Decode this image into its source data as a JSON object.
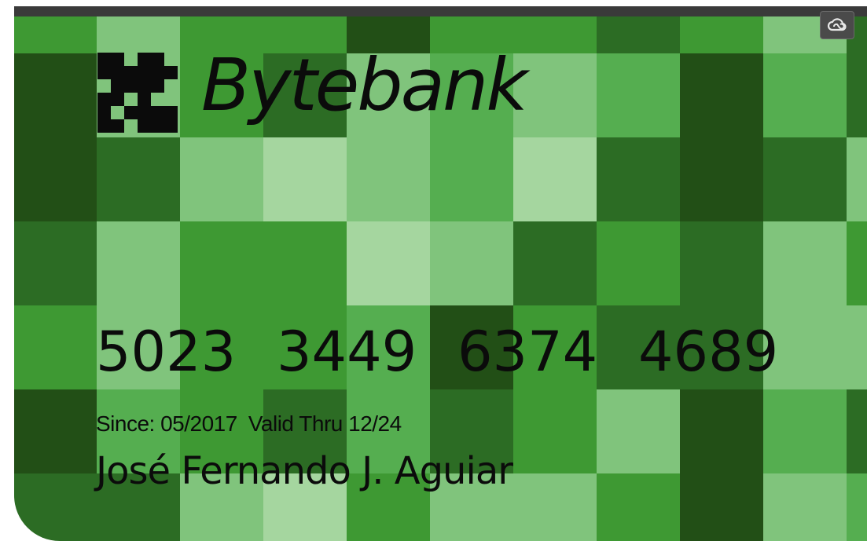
{
  "card": {
    "brand": "Bytebank",
    "logo_icon": "bytebank-pixel-logo-icon",
    "number_groups": [
      "5023",
      "3449",
      "6374",
      "4689"
    ],
    "since_label": "Since: 05/2017",
    "valid_label": "Valid Thru 12/24",
    "holder_name": "José Fernando J. Aguiar"
  },
  "toolbar": {
    "cloud_icon": "creative-cloud-icon"
  },
  "colors": {
    "top_bar": "#3a3a3a",
    "text": "#0b0b0b",
    "palette": {
      "D": "#224f16",
      "d": "#2c6c24",
      "M": "#3e9933",
      "m": "#55ae50",
      "l": "#80c47c",
      "L": "#a5d69f"
    },
    "tile_rows": [
      "MlMMDMMdMld",
      "DlMdlmlmDmd",
      "DdlLlmLdDdl",
      "dlMMLldMdlM",
      "MlMMmDMddll",
      "DmMdmdMlDmd",
      "ddlLMllMDlm"
    ]
  }
}
